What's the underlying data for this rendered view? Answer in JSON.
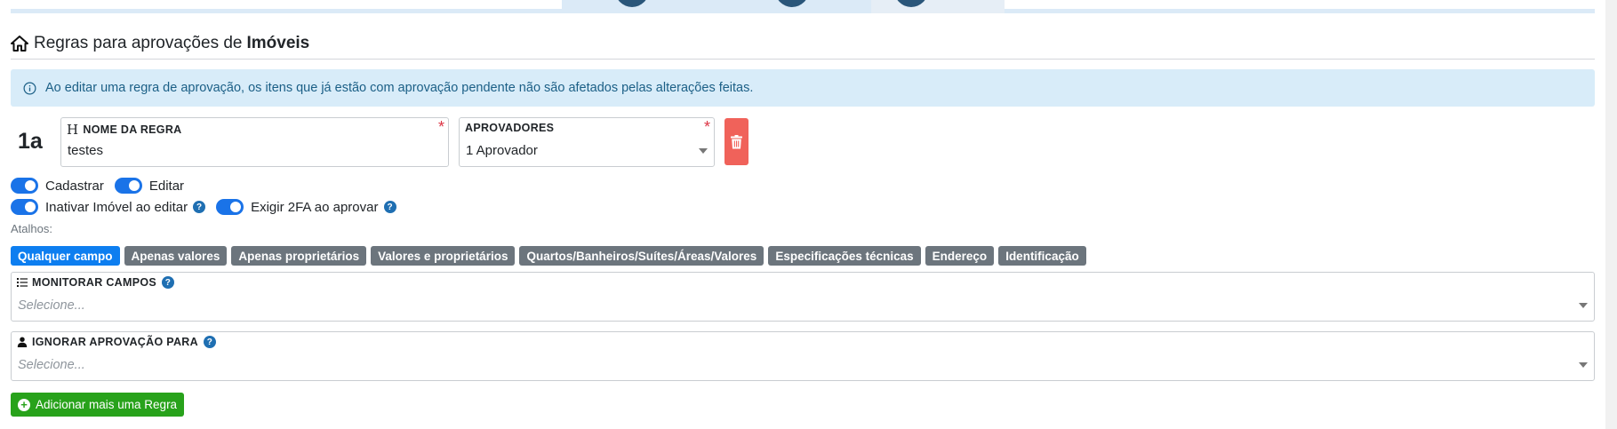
{
  "page": {
    "title_prefix": "Regras para aprovações de",
    "title_entity": "Imóveis",
    "icon": "home-icon"
  },
  "alert": {
    "icon": "info-circle-icon",
    "text": "Ao editar uma regra de aprovação, os itens que já estão com aprovação pendente não são afetados pelas alterações feitas."
  },
  "rule": {
    "number": "1a",
    "name_field": {
      "label": "NOME DA REGRA",
      "icon": "heading-icon",
      "value": "testes",
      "required_mark": "*"
    },
    "approvers_field": {
      "label": "APROVADORES",
      "value": "1 Aprovador",
      "required_mark": "*"
    },
    "delete_icon": "trash-icon",
    "toggles": [
      {
        "label": "Cadastrar",
        "on": true
      },
      {
        "label": "Editar",
        "on": true
      },
      {
        "label": "Inativar Imóvel ao editar",
        "on": true,
        "help": "?"
      },
      {
        "label": "Exigir 2FA ao aprovar",
        "on": true,
        "help": "?"
      }
    ],
    "shortcuts_label": "Atalhos:",
    "shortcuts": [
      {
        "label": "Qualquer campo",
        "active": true
      },
      {
        "label": "Apenas valores",
        "active": false
      },
      {
        "label": "Apenas proprietários",
        "active": false
      },
      {
        "label": "Valores e proprietários",
        "active": false
      },
      {
        "label": "Quartos/Banheiros/Suítes/Áreas/Valores",
        "active": false
      },
      {
        "label": "Especificações técnicas",
        "active": false
      },
      {
        "label": "Endereço",
        "active": false
      },
      {
        "label": "Identificação",
        "active": false
      }
    ],
    "monitor_field": {
      "label": "MONITORAR CAMPOS",
      "icon": "list-icon",
      "placeholder": "Selecione...",
      "help": "?"
    },
    "ignore_field": {
      "label": "IGNORAR APROVAÇÃO PARA",
      "icon": "user-icon",
      "placeholder": "Selecione...",
      "help": "?"
    }
  },
  "add_rule_button": {
    "label": "Adicionar mais uma Regra",
    "icon": "plus-circle-icon"
  },
  "colors": {
    "primary": "#1a73e8",
    "danger": "#f0625a",
    "success": "#28a21b",
    "info_bg": "#d8ecf9",
    "chip_gray": "#6c757d"
  }
}
